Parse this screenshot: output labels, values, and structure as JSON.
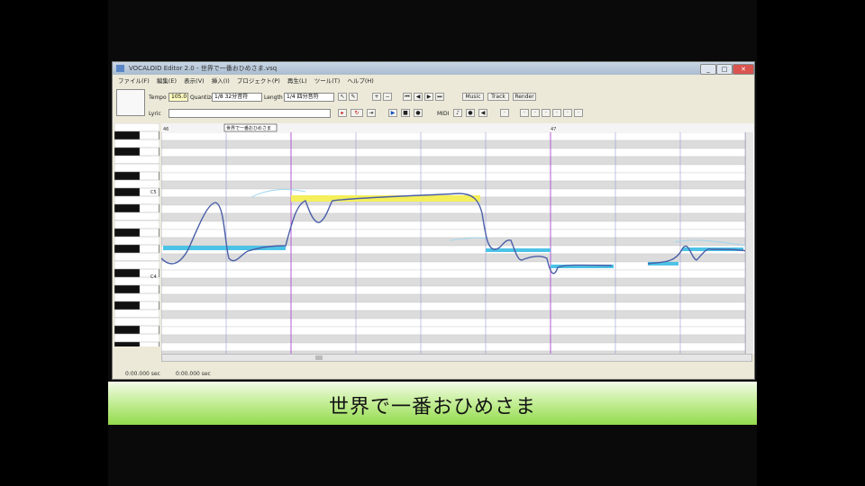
{
  "window": {
    "title": "VOCALOID Editor 2.0 - 世界で一番おひめさま.vsq"
  },
  "menu": [
    "ファイル(F)",
    "編集(E)",
    "表示(V)",
    "挿入(I)",
    "プロジェクト(P)",
    "再生(L)",
    "ツール(T)",
    "ヘルプ(H)"
  ],
  "toolbar": {
    "tempo_label": "Tempo",
    "tempo_value": "105.0",
    "quantize_label": "Quantize",
    "quantize_value": "1/8 32分音符",
    "length_label": "Length",
    "length_value": "1/4 四分音符",
    "lyric_label": "Lyric",
    "midi_label": "MIDI",
    "music_btn": "Music",
    "track_btn": "Track",
    "render_btn": "Render"
  },
  "ruler": {
    "measure_start": "46",
    "measure_mid": "47"
  },
  "track_label": "世界で一番おひめさま",
  "piano_labels": {
    "c5": "C5",
    "c4": "C4"
  },
  "status": {
    "left": "0:00.000 sec",
    "mid": "0:00.000 sec"
  },
  "subtitle": "世界で一番おひめさま",
  "colors": {
    "note_cyan": "#4cc3e6",
    "note_yellow": "#f4ef5a",
    "pitch_line": "#4a5fa8",
    "measure_line": "#9b6fd0",
    "subtitle_green": "#93db4d"
  }
}
